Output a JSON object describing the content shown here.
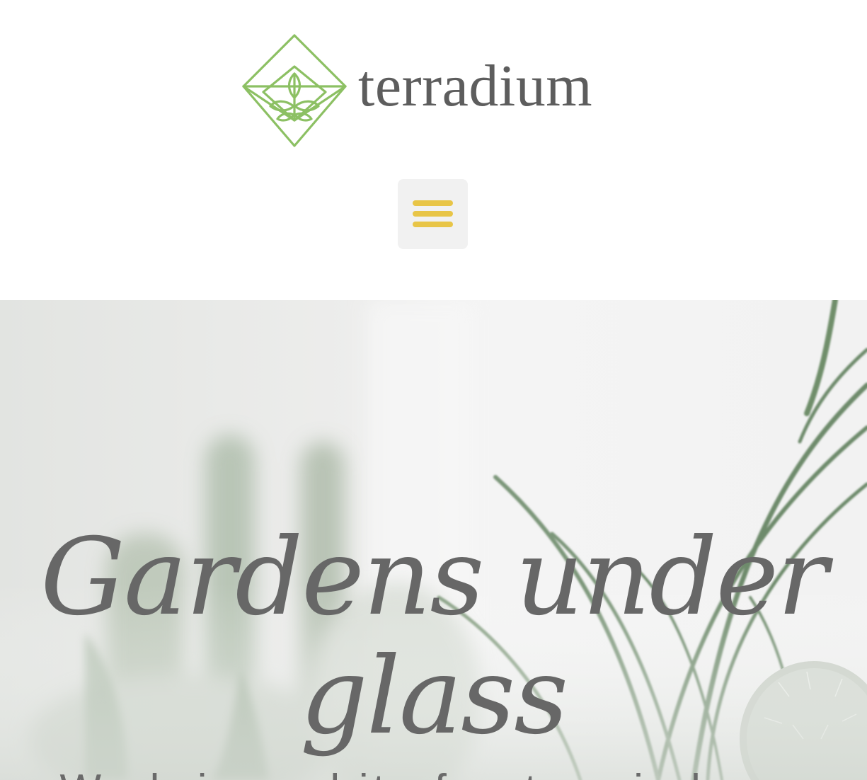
{
  "header": {
    "brand_name": "terradium",
    "logo_color": "#8cc063",
    "menu_button_color": "#e8c547",
    "menu_button_icon": "hamburger-menu-icon"
  },
  "hero": {
    "title_line_1": "Gardens under",
    "title_line_2": "glass",
    "subtitle": "We bring a bit of nature indoors",
    "background_image": "blurred cacti and air plants on white background"
  },
  "colors": {
    "text_gray": "#676767",
    "menu_bg": "#f1f1f1",
    "accent_yellow": "#e8c547",
    "brand_green": "#8cc063"
  }
}
